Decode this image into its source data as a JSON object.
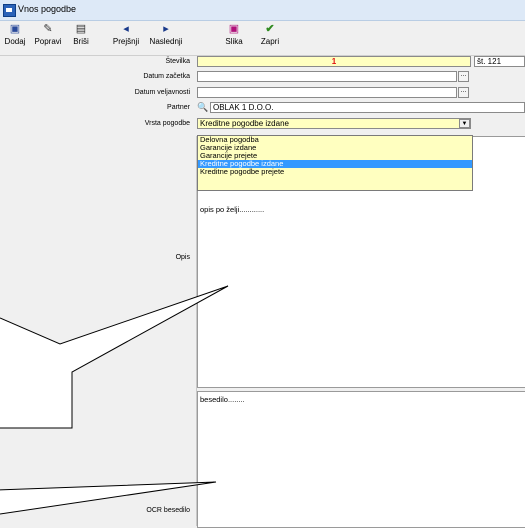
{
  "window": {
    "title": "Vnos pogodbe"
  },
  "toolbar": {
    "add": "Dodaj",
    "edit": "Popravi",
    "delete": "Briši",
    "prev": "Prejšnji",
    "next": "Naslednji",
    "image": "Slika",
    "close": "Zapri"
  },
  "form": {
    "number_label": "Številka",
    "number_value": "1",
    "number_suffix": "št. 121",
    "start_date_label": "Datum začetka",
    "start_date_value": "",
    "valid_date_label": "Datum veljavnosti",
    "valid_date_value": "",
    "partner_label": "Partner",
    "partner_value": "OBLAK 1 D.O.O.",
    "type_label": "Vrsta pogodbe",
    "type_value": "Kreditne pogodbe izdane",
    "type_options": [
      "Delovna pogodba",
      "Garancije izdane",
      "Garancije prejete",
      "Kreditne pogodbe izdane",
      "Kreditne pogodbe prejete"
    ],
    "description_label": "Opis",
    "description_value": "opis po želji............",
    "ocr_label": "OCR besedilo",
    "ocr_value": "besedilo........"
  },
  "colors": {
    "highlight_field": "#ffffc0",
    "selected_option": "#3399ff",
    "number_text": "#e01010"
  }
}
